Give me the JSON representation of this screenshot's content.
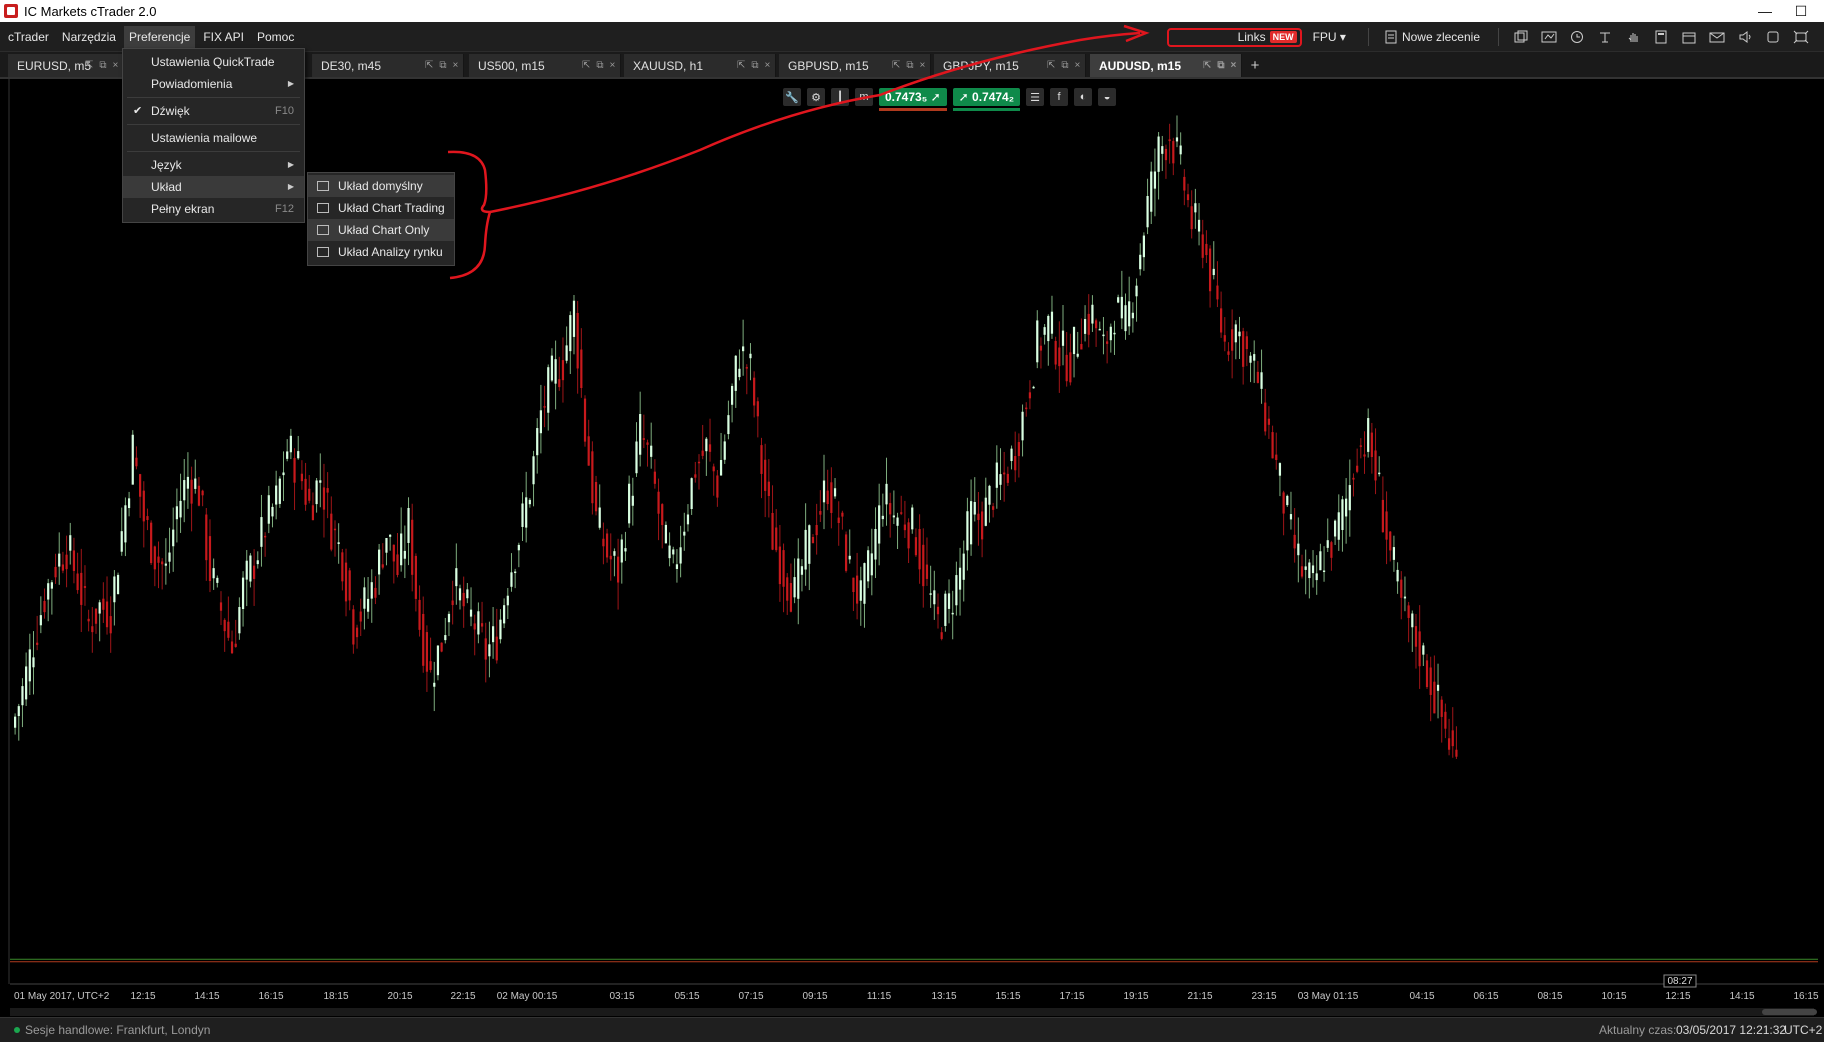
{
  "window": {
    "title": "IC Markets cTrader 2.0",
    "minimize_glyph": "—",
    "maximize_glyph": "☐"
  },
  "menubar": {
    "items": [
      "cTrader",
      "Narzędzia",
      "Preferencje",
      "FIX API",
      "Pomoc"
    ],
    "active_index": 2,
    "links_label": "Links",
    "links_badge": "NEW",
    "fpu_label": "FPU ▾",
    "new_order_label": "Nowe zlecenie"
  },
  "tabs": [
    {
      "label": "EURUSD, m5"
    },
    {
      "label": "DE30, m45"
    },
    {
      "label": "US500, m15"
    },
    {
      "label": "XAUUSD, h1"
    },
    {
      "label": "GBPUSD, m15"
    },
    {
      "label": "GBPJPY, m15"
    },
    {
      "label": "AUDUSD, m15"
    }
  ],
  "tab_add": "+",
  "tab_ctl_glyphs": [
    "⇱",
    "⧉",
    "×"
  ],
  "chart_toolbar": {
    "bid": "0.7473₅",
    "ask": "0.7474₂",
    "bid_arrow": "➚",
    "ask_arrow": "➚",
    "bid_bar_color": "#b03a1e",
    "ask_bar_color": "#0f8a4a"
  },
  "preferences_menu": {
    "items": [
      {
        "label": "Ustawienia QuickTrade",
        "type": "item"
      },
      {
        "label": "Powiadomienia",
        "type": "submenu"
      },
      {
        "type": "separator"
      },
      {
        "label": "Dźwięk",
        "type": "check",
        "checked": true,
        "key": "F10"
      },
      {
        "type": "separator"
      },
      {
        "label": "Ustawienia mailowe",
        "type": "item"
      },
      {
        "type": "separator"
      },
      {
        "label": "Język",
        "type": "submenu"
      },
      {
        "label": "Układ",
        "type": "submenu",
        "hover": true
      },
      {
        "label": "Pełny ekran",
        "type": "item",
        "key": "F12"
      }
    ],
    "check_glyph": "✔",
    "arrow_glyph": "▶"
  },
  "layout_submenu": {
    "items": [
      {
        "label": "Układ domyślny",
        "hover": true
      },
      {
        "label": "Układ Chart Trading"
      },
      {
        "label": "Układ Chart Only",
        "hover": true
      },
      {
        "label": "Układ Analizy rynku"
      }
    ]
  },
  "chart_data": {
    "type": "candlestick",
    "symbol": "AUDUSD",
    "timeframe": "m15",
    "x_labels": [
      "01 May 2017, UTC+2",
      "12:15",
      "14:15",
      "16:15",
      "18:15",
      "20:15",
      "22:15",
      "02 May 00:15",
      "03:15",
      "05:15",
      "07:15",
      "09:15",
      "11:15",
      "13:15",
      "15:15",
      "17:15",
      "19:15",
      "21:15",
      "23:15",
      "03 May 01:15",
      "04:15",
      "06:15",
      "08:15",
      "10:15",
      "12:15",
      "14:15",
      "16:15"
    ],
    "current_time_label": "08:27",
    "bid_line": 0.74735,
    "ask_line": 0.74742,
    "up_color": "#d9ffe2",
    "down_color": "#c8191c",
    "bid_line_color": "#b03a1e",
    "ask_line_color": "#3b8a2a",
    "price_path": [
      0.754,
      0.7551,
      0.7565,
      0.7578,
      0.7587,
      0.7592,
      0.7583,
      0.757,
      0.7575,
      0.7574,
      0.7596,
      0.762,
      0.76,
      0.759,
      0.7585,
      0.7603,
      0.7612,
      0.7608,
      0.7585,
      0.7574,
      0.7563,
      0.758,
      0.7588,
      0.7598,
      0.7605,
      0.762,
      0.7615,
      0.7604,
      0.7612,
      0.7598,
      0.7589,
      0.757,
      0.7575,
      0.7583,
      0.7596,
      0.7585,
      0.7598,
      0.757,
      0.7555,
      0.7565,
      0.7582,
      0.7575,
      0.757,
      0.7562,
      0.7566,
      0.7583,
      0.7595,
      0.7609,
      0.763,
      0.764,
      0.7645,
      0.766,
      0.7625,
      0.76,
      0.759,
      0.7585,
      0.7605,
      0.7625,
      0.7615,
      0.7595,
      0.7585,
      0.76,
      0.7615,
      0.762,
      0.761,
      0.763,
      0.7648,
      0.7642,
      0.7615,
      0.7595,
      0.7585,
      0.7578,
      0.759,
      0.76,
      0.761,
      0.76,
      0.7585,
      0.7576,
      0.759,
      0.7606,
      0.7601,
      0.76,
      0.7595,
      0.758,
      0.757,
      0.7575,
      0.7585,
      0.7601,
      0.76,
      0.7608,
      0.7612,
      0.762,
      0.7634,
      0.765,
      0.7655,
      0.7648,
      0.7645,
      0.7655,
      0.7658,
      0.7648,
      0.766,
      0.7655,
      0.767,
      0.769,
      0.7705,
      0.771,
      0.77,
      0.7685,
      0.768,
      0.7665,
      0.765,
      0.7655,
      0.7647,
      0.764,
      0.7625,
      0.761,
      0.7595,
      0.7585,
      0.7581,
      0.759,
      0.7595,
      0.7605,
      0.762,
      0.7623,
      0.7608,
      0.759,
      0.7575,
      0.7568,
      0.756,
      0.755,
      0.754,
      0.753
    ]
  },
  "status": {
    "sessions_label": "Sesje handlowe:",
    "sessions_value": "Frankfurt, Londyn",
    "time_label": "Aktualny czas:",
    "time_value": "03/05/2017 12:21:32",
    "tz": "UTC+2"
  }
}
